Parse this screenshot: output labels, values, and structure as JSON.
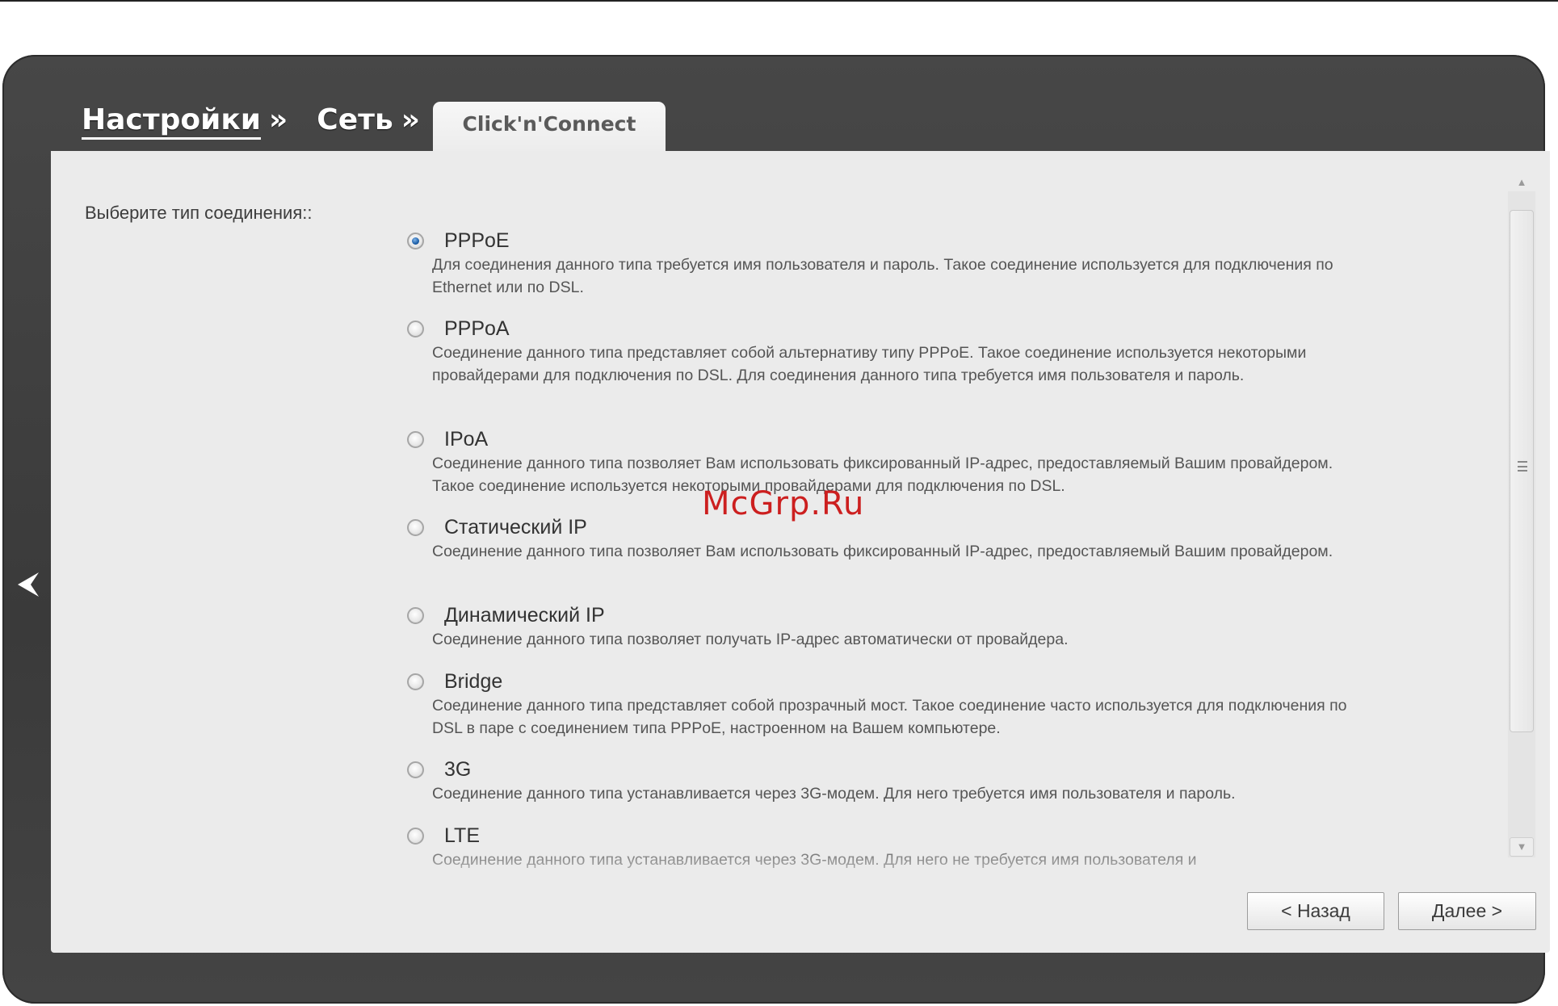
{
  "breadcrumb": {
    "settings_label": "Настройки",
    "network_label": "Сеть",
    "separator": "»"
  },
  "tab": {
    "active_label": "Click'n'Connect"
  },
  "form": {
    "section_label": "Выберите тип соединения::",
    "selected_option": "PPPoE",
    "options": [
      {
        "title": "PPPoE",
        "description": "Для соединения данного типа требуется имя пользователя и пароль. Такое соединение используется для подключения по Ethernet или по DSL."
      },
      {
        "title": "PPPoA",
        "description": "Соединение данного типа представляет собой альтернативу типу PPPoE. Такое соединение используется некоторыми провайдерами для подключения по DSL. Для соединения данного типа требуется имя пользователя и пароль."
      },
      {
        "title": "IPoA",
        "description": "Соединение данного типа позволяет Вам использовать фиксированный IP-адрес, предоставляемый Вашим провайдером. Такое соединение используется некоторыми провайдерами для подключения по DSL."
      },
      {
        "title": "Статический IP",
        "description": "Соединение данного типа позволяет Вам использовать фиксированный IP-адрес, предоставляемый Вашим провайдером."
      },
      {
        "title": "Динамический IP",
        "description": "Соединение данного типа позволяет получать IP-адрес автоматически от провайдера."
      },
      {
        "title": "Bridge",
        "description": "Соединение данного типа представляет собой прозрачный мост. Такое соединение часто используется для подключения по DSL в паре с соединением типа PPPoE, настроенном на Вашем компьютере."
      },
      {
        "title": "3G",
        "description": "Соединение данного типа устанавливается через 3G-модем. Для него требуется имя пользователя и пароль."
      },
      {
        "title": "LTE",
        "description": "Соединение данного типа устанавливается через 3G-модем. Для него не требуется имя пользователя и"
      }
    ]
  },
  "buttons": {
    "back_label": "< Назад",
    "next_label": "Далее >"
  },
  "watermark": "McGrp.Ru",
  "icons": {
    "nav_back": "chevron-left-icon",
    "scroll_up": "arrow-up-icon",
    "scroll_down": "arrow-down-icon",
    "scroll_grip": "grip-lines-icon"
  },
  "colors": {
    "frame": "#3f3f3f",
    "panel": "#ebebeb",
    "radio_checked": "#1d5fa8",
    "watermark": "#cc1f1f"
  }
}
